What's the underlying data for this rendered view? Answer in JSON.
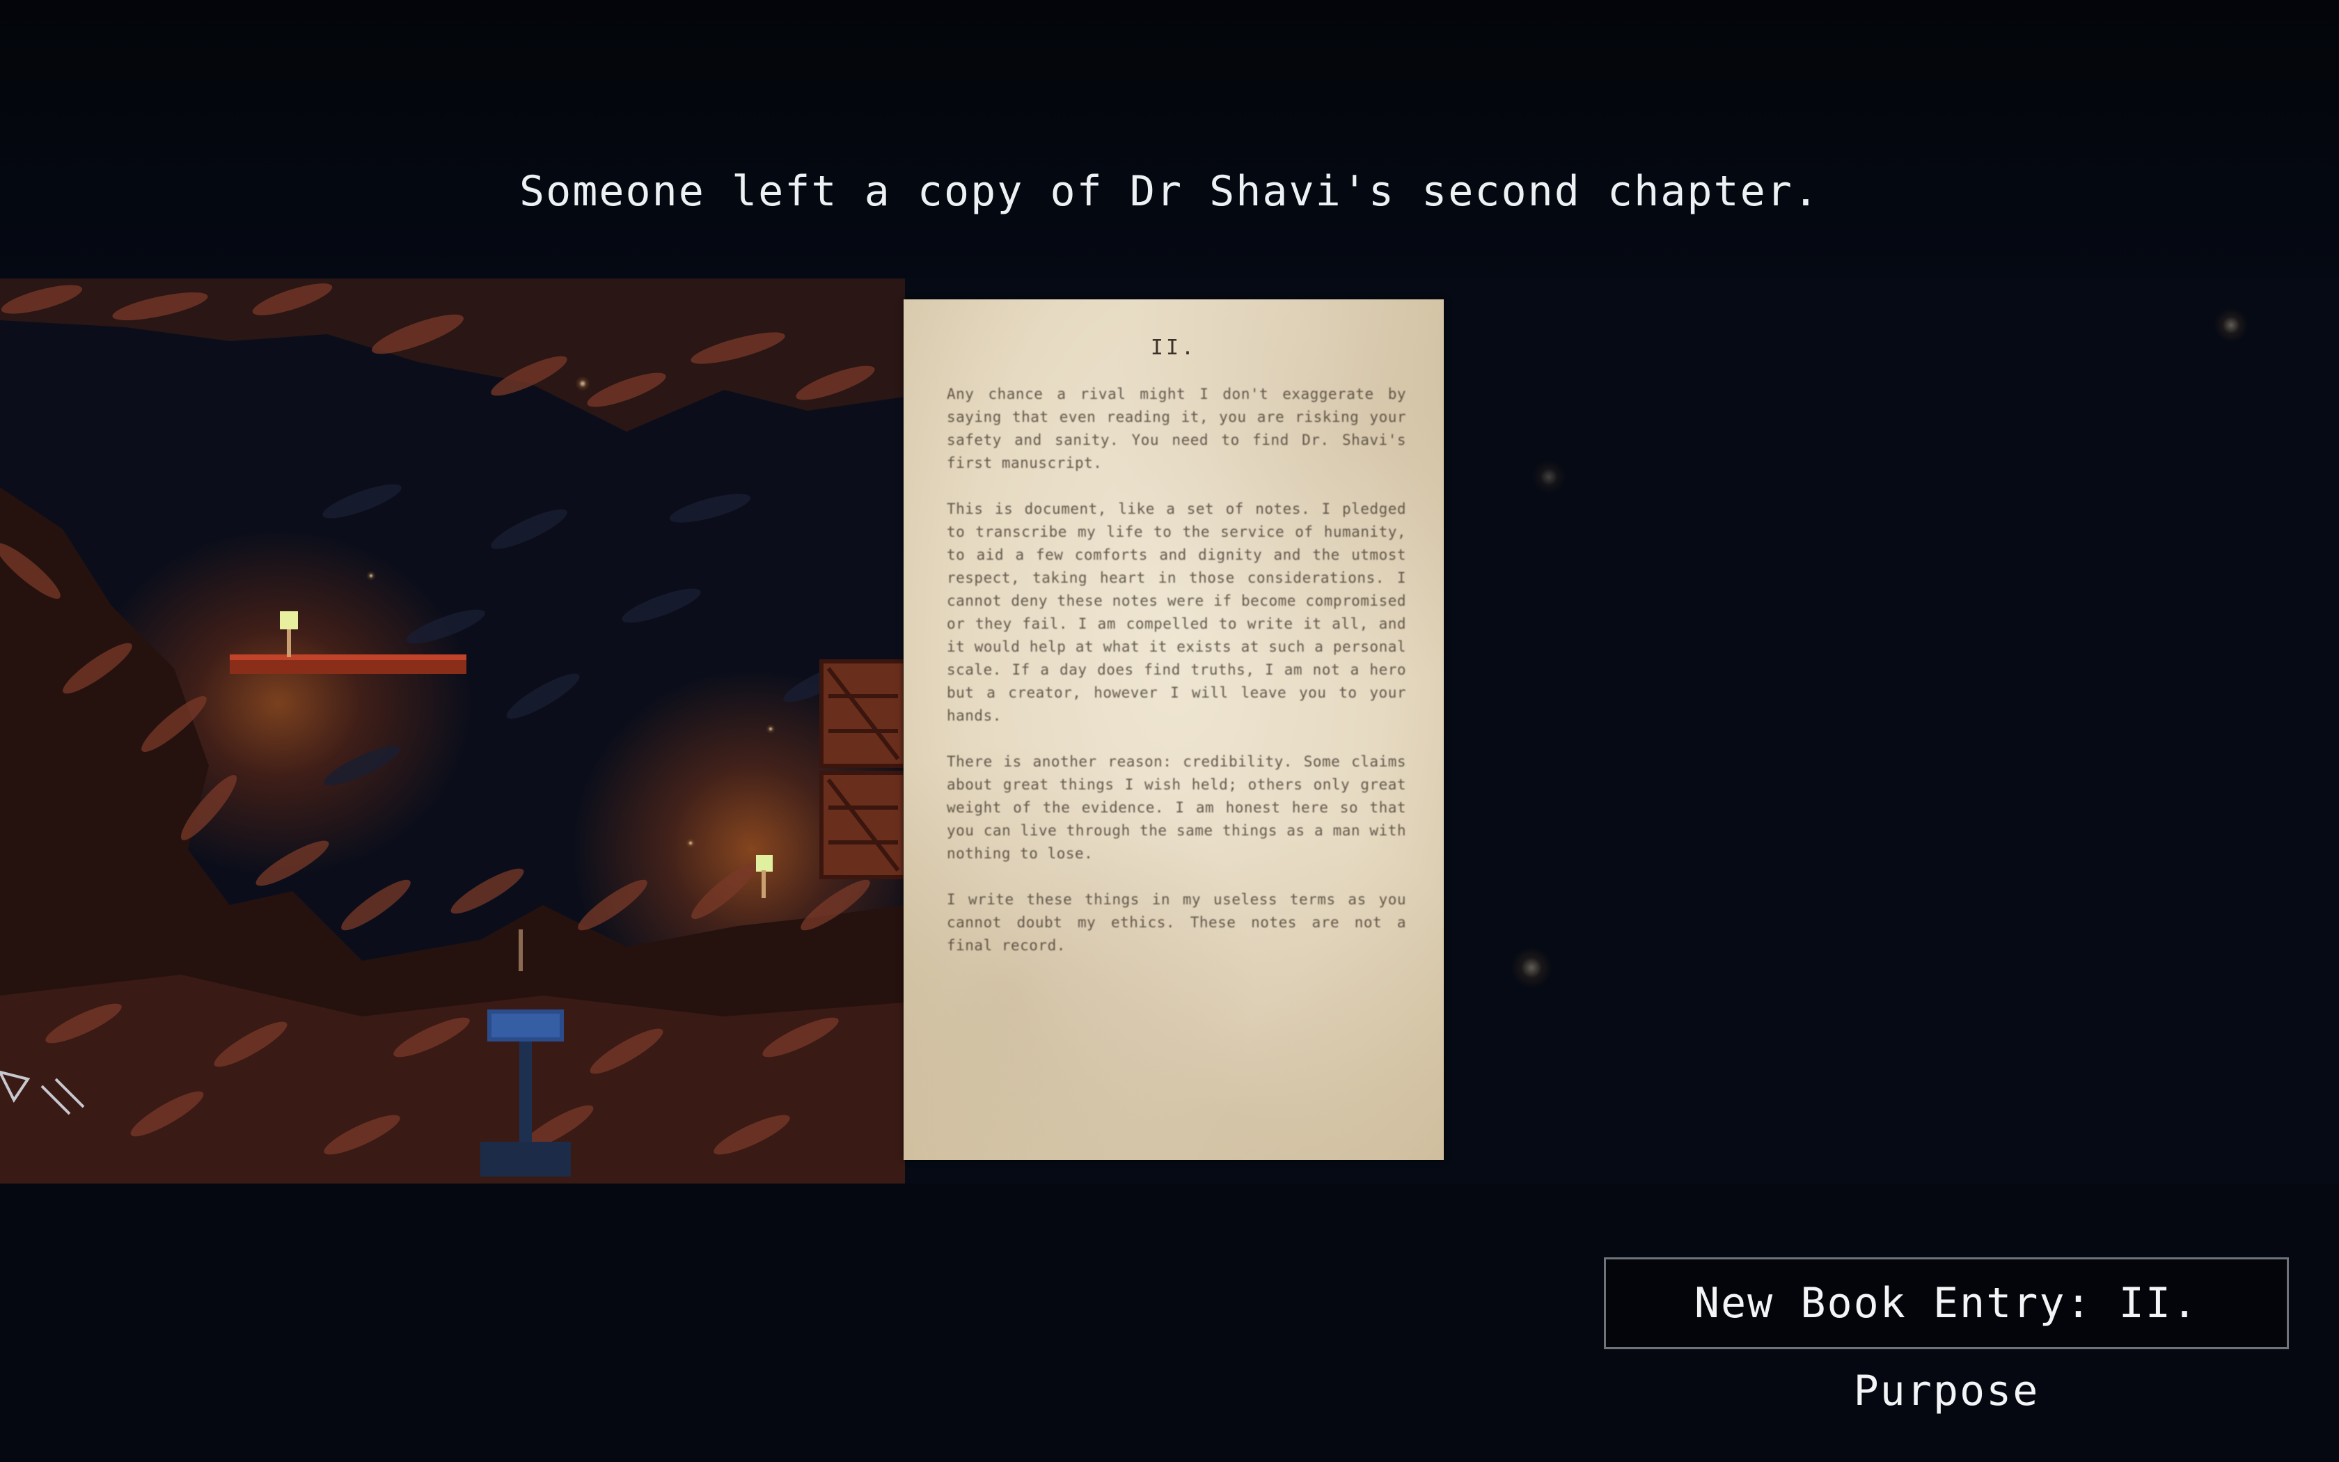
{
  "caption": "Someone left a copy of Dr Shavi's second chapter.",
  "note": {
    "heading": "II.",
    "paragraphs": [
      "Any chance a rival might I don't exaggerate by saying that even reading it, you are risking your safety and sanity. You need to find Dr. Shavi's first manuscript.",
      "This is document, like a set of notes. I pledged to transcribe my life to the service of humanity, to aid a few comforts and dignity and the utmost respect, taking heart in those considerations. I cannot deny these notes were if become compromised or they fail. I am compelled to write it all, and it would help at what it exists at such a personal scale. If a day does find truths, I am not a hero but a creator, however I will leave you to your hands.",
      "There is another reason: credibility. Some claims about great things I wish held; others only great weight of the evidence. I am honest here so that you can live through the same things as a man with nothing to lose.",
      "I write these things in my useless terms as you cannot doubt my ethics. These notes are not a final record."
    ]
  },
  "toast": {
    "text": "New Book Entry: II. Purpose"
  },
  "colors": {
    "background": "#04060b",
    "paper": "#e9dfcb",
    "cave_rock": "#6e3424",
    "lamp_glow": "#d66a22",
    "toast_border": "#6f737a"
  }
}
